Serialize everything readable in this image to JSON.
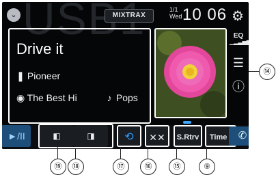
{
  "header": {
    "background_word": "USB1",
    "mixtrax_label": "MIXTRAX",
    "date_fraction": "1/1",
    "weekday": "Wed",
    "clock": "10 06"
  },
  "track": {
    "title": "Drive it",
    "artist": "Pioneer",
    "album": "The Best Hi",
    "genre": "Pops"
  },
  "side": {
    "eq_label": "EQ"
  },
  "bottom_bar": {
    "play_pause_label": "►/II",
    "shuffle_label": "✕✕",
    "sound_retriever_label": "S.Rtrv",
    "time_label": "Time ‹"
  },
  "callouts": {
    "c19": "⑲",
    "c18": "⑱",
    "c17": "⑰",
    "c16": "⑯",
    "c15": "⑮",
    "c9": "⑨",
    "c14": "⑭"
  },
  "colors": {
    "accent_blue": "#2b9cff",
    "play_button_bg": "#1d4f7a",
    "screen_bg": "#050608"
  }
}
